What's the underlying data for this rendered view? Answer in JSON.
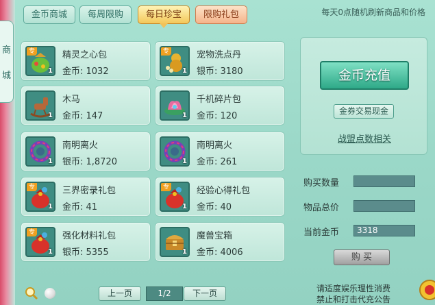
{
  "side": {
    "label_top": "商",
    "label_bottom": "城"
  },
  "tabs": [
    {
      "label": "金币商城",
      "state": "normal"
    },
    {
      "label": "每周限购",
      "state": "normal"
    },
    {
      "label": "每日珍宝",
      "state": "active"
    },
    {
      "label": "限购礼包",
      "state": "gift"
    }
  ],
  "notice": "每天0点随机刷新商品和价格",
  "items": [
    {
      "name": "精灵之心包",
      "price": "金币: 1032",
      "qty": "1",
      "tag": "专",
      "icon": "gift-bag-icon"
    },
    {
      "name": "宠物洗点丹",
      "price": "银币: 3180",
      "qty": "1",
      "tag": "专",
      "icon": "gourd-pill-icon"
    },
    {
      "name": "木马",
      "price": "金币: 147",
      "qty": "1",
      "tag": "",
      "icon": "rocking-horse-icon"
    },
    {
      "name": "千机碎片包",
      "price": "金币: 120",
      "qty": "1",
      "tag": "",
      "icon": "lotus-fragment-icon"
    },
    {
      "name": "南明离火",
      "price": "银币: 1,8720",
      "qty": "1",
      "tag": "",
      "icon": "fire-ring-icon"
    },
    {
      "name": "南明离火",
      "price": "金币: 261",
      "qty": "1",
      "tag": "",
      "icon": "fire-ring-icon"
    },
    {
      "name": "三界密录礼包",
      "price": "金币: 41",
      "qty": "1",
      "tag": "专",
      "icon": "red-gift-bag-icon"
    },
    {
      "name": "经验心得礼包",
      "price": "金币: 40",
      "qty": "1",
      "tag": "专",
      "icon": "red-gift-bag-icon"
    },
    {
      "name": "强化材料礼包",
      "price": "银币: 5355",
      "qty": "1",
      "tag": "专",
      "icon": "red-gift-bag-icon"
    },
    {
      "name": "魔兽宝箱",
      "price": "金币: 4006",
      "qty": "1",
      "tag": "",
      "icon": "treasure-chest-icon"
    }
  ],
  "right_panel": {
    "recharge_label": "金币充值",
    "exchange_label": "金券交易现金",
    "alliance_label": "战盟点数相关"
  },
  "form": {
    "qty_label": "购买数量",
    "qty_value": "",
    "total_label": "物品总价",
    "total_value": "",
    "current_label": "当前金币",
    "current_value": "3318",
    "buy_label": "购 买"
  },
  "pager": {
    "prev_label": "上一页",
    "page": "1/2",
    "next_label": "下一页"
  },
  "footer": {
    "line1": "请适度娱乐理性消费",
    "line2": "禁止和打击代充公告"
  },
  "colors": {
    "accent": "#2ea988",
    "active_tab": "#f3c85a",
    "gift_tab": "#f5b38a"
  }
}
